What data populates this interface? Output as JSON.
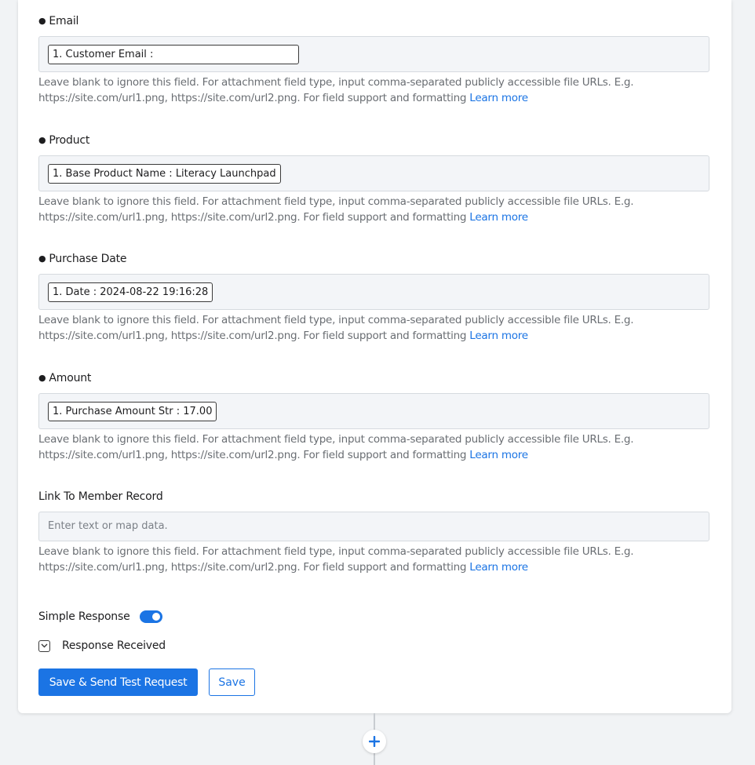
{
  "help_text": "Leave blank to ignore this field. For attachment field type, input comma-separated publicly accessible file URLs. E.g. https://site.com/url1.png, https://site.com/url2.png. For field support and formatting ",
  "learn_more": "Learn more",
  "fields": [
    {
      "bullet": "●",
      "label": "Email",
      "value": "1. Customer Email : "
    },
    {
      "bullet": "●",
      "label": "Product",
      "value": "1. Base Product Name : Literacy Launchpad"
    },
    {
      "bullet": "●",
      "label": "Purchase Date",
      "value": "1. Date : 2024-08-22 19:16:28"
    },
    {
      "bullet": "●",
      "label": "Amount",
      "value": "1. Purchase Amount Str : 17.00"
    },
    {
      "label": "Link To Member Record",
      "placeholder": "Enter text or map data."
    }
  ],
  "simple_response": {
    "label": "Simple Response",
    "enabled": true
  },
  "response_received": {
    "label": "Response Received"
  },
  "buttons": {
    "save_send": "Save & Send Test Request",
    "save": "Save"
  },
  "colors": {
    "accent": "#1b74e4",
    "input_bg": "#f3f5f8",
    "help_text": "#6a6e73"
  },
  "icons": {
    "chevron": "chevron-down-icon",
    "add": "plus-icon"
  }
}
